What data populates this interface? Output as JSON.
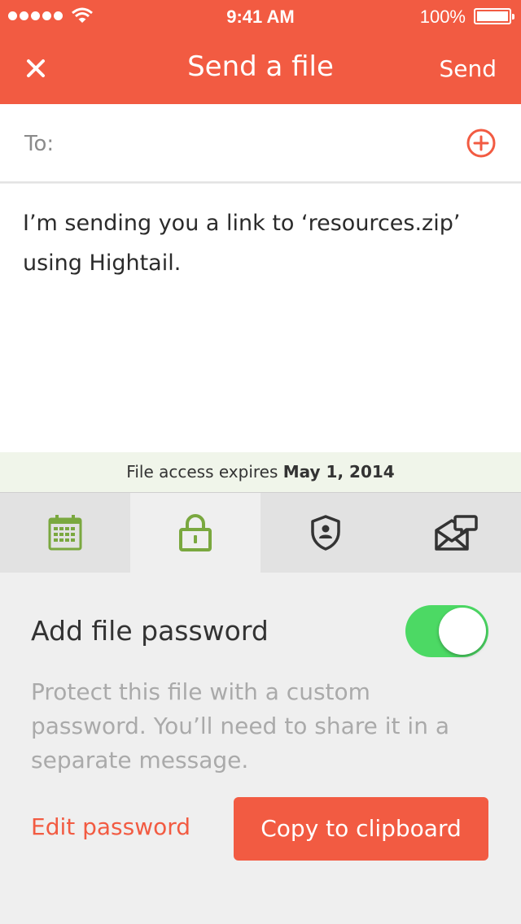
{
  "status_bar": {
    "time": "9:41 AM",
    "battery": "100%"
  },
  "header": {
    "title": "Send a file",
    "send_label": "Send"
  },
  "to_field": {
    "label": "To:"
  },
  "message": {
    "text": "I’m sending you a link to ‘resources.zip’ using Hightail."
  },
  "expiry": {
    "prefix": "File access expires",
    "date": "May 1, 2014"
  },
  "tabs": [
    {
      "icon": "calendar-icon",
      "active": false
    },
    {
      "icon": "lock-icon",
      "active": true
    },
    {
      "icon": "shield-user-icon",
      "active": false
    },
    {
      "icon": "envelope-comment-icon",
      "active": false
    }
  ],
  "password_panel": {
    "title": "Add file password",
    "toggle_on": true,
    "description": "Protect this file with a custom password. You’ll need to share it in a separate message.",
    "edit_label": "Edit password",
    "copy_label": "Copy to clipboard"
  },
  "colors": {
    "accent": "#f25b42",
    "green_icon": "#7aa83f",
    "toggle_on": "#4cd964"
  }
}
